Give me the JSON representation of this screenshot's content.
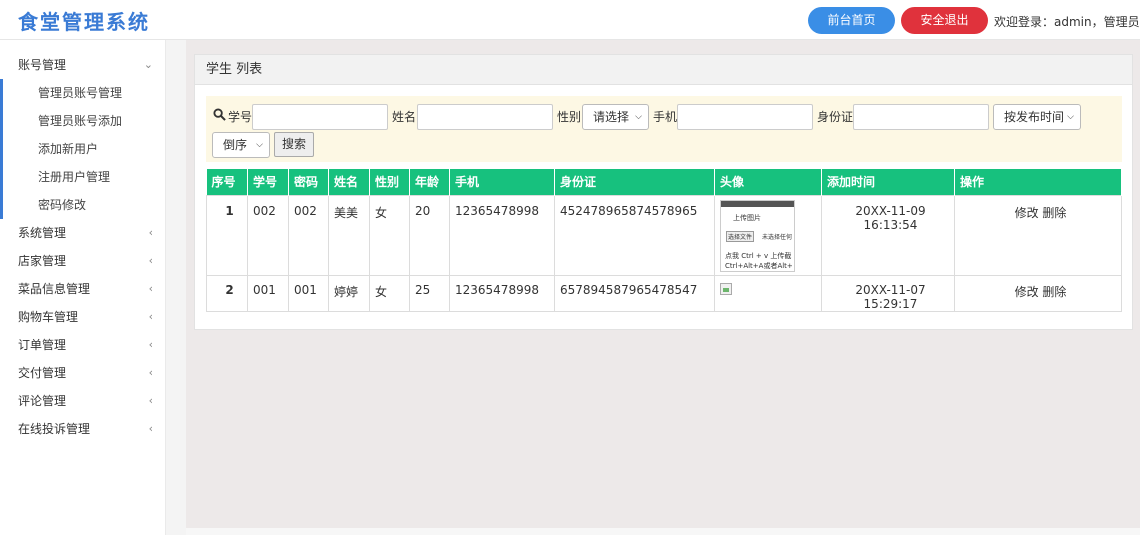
{
  "header": {
    "title": "食堂管理系统",
    "home_button": "前台首页",
    "logout_button": "安全退出",
    "welcome": "欢迎登录：admin，管理员"
  },
  "sidebar": {
    "groups": [
      {
        "label": "账号管理",
        "expanded": true,
        "items": [
          "管理员账号管理",
          "管理员账号添加",
          "添加新用户",
          "注册用户管理",
          "密码修改"
        ]
      },
      {
        "label": "系统管理"
      },
      {
        "label": "店家管理"
      },
      {
        "label": "菜品信息管理"
      },
      {
        "label": "购物车管理"
      },
      {
        "label": "订单管理"
      },
      {
        "label": "交付管理"
      },
      {
        "label": "评论管理"
      },
      {
        "label": "在线投诉管理"
      }
    ]
  },
  "panel": {
    "title": "学生 列表"
  },
  "search": {
    "label_student_no": "学号",
    "label_name": "姓名",
    "label_gender": "性别",
    "gender_select": "请选择",
    "label_phone": "手机",
    "label_id_card": "身份证",
    "sort_select": "按发布时间",
    "order_select": "倒序",
    "search_button": "搜索"
  },
  "table": {
    "headers": [
      "序号",
      "学号",
      "密码",
      "姓名",
      "性别",
      "年龄",
      "手机",
      "身份证",
      "头像",
      "添加时间",
      "操作"
    ],
    "rows": [
      {
        "index": "1",
        "student_no": "002",
        "password": "002",
        "name": "美美",
        "gender": "女",
        "age": "20",
        "phone": "12365478998",
        "id_card": "452478965874578965",
        "added": "20XX-11-09 16:13:54",
        "edit": "修改",
        "delete": "删除"
      },
      {
        "index": "2",
        "student_no": "001",
        "password": "001",
        "name": "婷婷",
        "gender": "女",
        "age": "25",
        "phone": "12365478998",
        "id_card": "657894587965478547",
        "added": "20XX-11-07 15:29:17",
        "edit": "修改",
        "delete": "删除"
      }
    ],
    "avatar_thumb": {
      "title": "上传图片",
      "file_button": "选择文件",
      "file_note": "未选择任何",
      "line1": "点我 Ctrl + v 上传截",
      "line2": "Ctrl+Alt+A或者Alt+"
    }
  },
  "colors": {
    "brand": "#3a7bd5",
    "home_button": "#3a8ee6",
    "logout_button": "#e0323c",
    "table_header": "#17c17e",
    "search_bg": "#fdf8e4"
  }
}
